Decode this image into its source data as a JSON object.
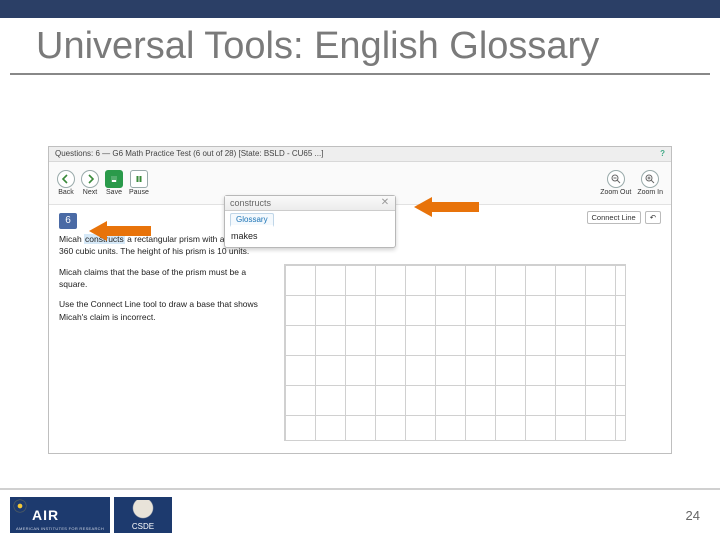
{
  "slide": {
    "title": "Universal Tools: English Glossary",
    "page_number": "24"
  },
  "header": {
    "left": "Questions:  6  —  G6 Math Practice Test (6 out of 28)   [State: BSLD - CU65 ...]",
    "right_icon": "?"
  },
  "toolbar": {
    "back": "Back",
    "next": "Next",
    "save": "Save",
    "pause": "Pause",
    "zoom_out": "Zoom Out",
    "zoom_in": "Zoom In"
  },
  "question": {
    "number": "6",
    "highlighted": "constructs",
    "p1_rest": " a rectangular prism with a volume of 360 cubic units. The height of his prism is 10 units.",
    "p1_lead": "Micah ",
    "p2": "Micah claims that the base of the prism must be a square.",
    "p3": "Use the Connect Line tool to draw a base that shows Micah's claim is incorrect."
  },
  "tool_row": {
    "connect": "Connect Line",
    "undo": "↶"
  },
  "popup": {
    "title": "constructs",
    "tab": "Glossary",
    "body": "makes"
  },
  "logos": {
    "air_text": "AIR",
    "air_sub": "AMERICAN INSTITUTES FOR RESEARCH",
    "csde_text": "CSDE"
  }
}
